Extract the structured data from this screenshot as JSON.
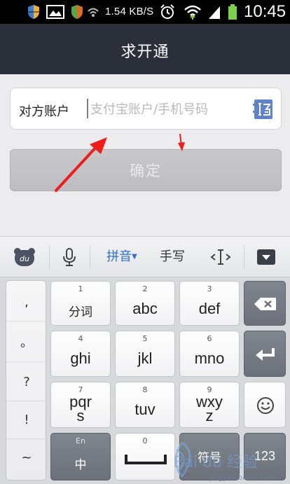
{
  "status_bar": {
    "network_speed": "1.54 KB/S",
    "time": "10:45"
  },
  "header": {
    "title": "求开通"
  },
  "account": {
    "label": "对方账户",
    "value": "",
    "placeholder": "支付宝账户/手机号码"
  },
  "confirm": {
    "label": "确定"
  },
  "keyboard": {
    "toolbar": {
      "logo": "du",
      "pinyin": "拼音",
      "handwriting": "手写"
    },
    "punctuation": [
      ",",
      "。",
      "?",
      "!",
      "~"
    ],
    "keys": {
      "k1": {
        "num": "1",
        "label": "分词"
      },
      "k2": {
        "num": "2",
        "label": "abc"
      },
      "k3": {
        "num": "3",
        "label": "def"
      },
      "k4": {
        "num": "4",
        "label": "ghi"
      },
      "k5": {
        "num": "5",
        "label": "jkl"
      },
      "k6": {
        "num": "6",
        "label": "mno"
      },
      "k7": {
        "num": "7",
        "label": "pqr s"
      },
      "k7a": "pqr",
      "k7b": "s",
      "k8": {
        "num": "8",
        "label": "tuv"
      },
      "k9": {
        "num": "9",
        "label": "wxy z"
      },
      "k9a": "wxy",
      "k9b": "z",
      "lang_small": "En",
      "lang_main": "中",
      "space_num": "0",
      "symbol": "符号",
      "numbers": "123"
    }
  },
  "watermark": {
    "text": "Bai du 经验",
    "url": "jingyan.baidu.com"
  }
}
